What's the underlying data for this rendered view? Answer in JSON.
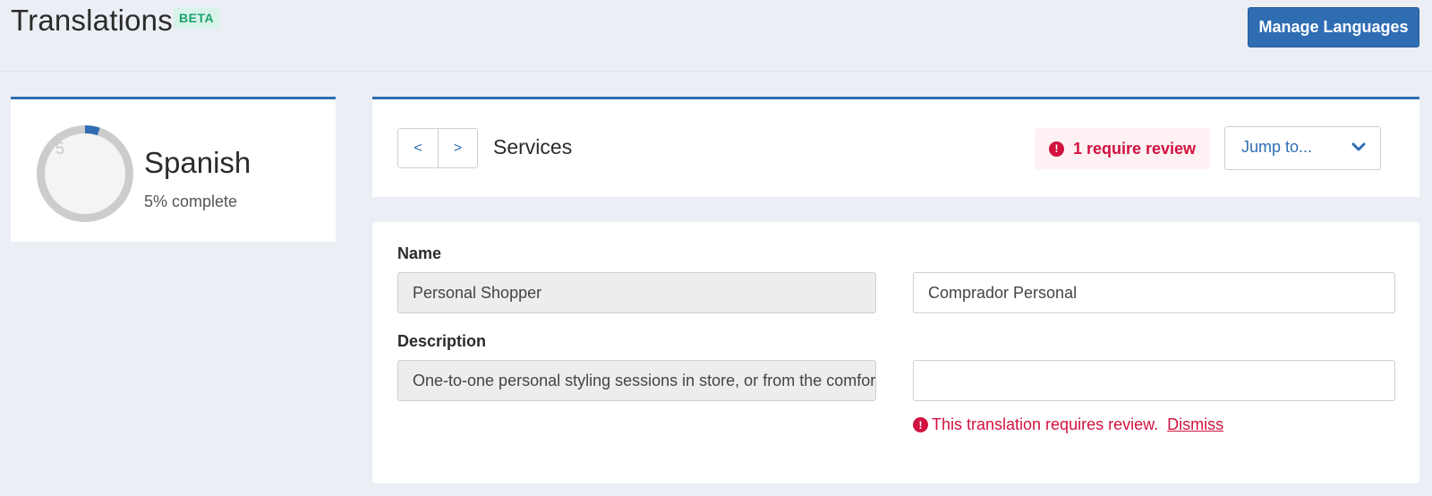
{
  "header": {
    "title": "Translations",
    "badge": "BETA",
    "manage_button": "Manage Languages"
  },
  "language": {
    "name": "Spanish",
    "progress_percent": 5,
    "ring_label": "5",
    "complete_text": "5% complete"
  },
  "section": {
    "prev_label": "<",
    "next_label": ">",
    "title": "Services",
    "review_count_text": "1 require review",
    "jump_label": "Jump to..."
  },
  "fields": [
    {
      "label": "Name",
      "source_value": "Personal Shopper",
      "target_value": "Comprador Personal"
    },
    {
      "label": "Description",
      "source_value": "One-to-one personal styling sessions in store, or from the comfort",
      "target_value": "",
      "review_message": "This translation requires review.",
      "dismiss_label": "Dismiss"
    }
  ],
  "colors": {
    "accent": "#2f6db3",
    "alert": "#d1123f",
    "badge_green": "#1aa36a",
    "ring_track": "#cccccc"
  }
}
